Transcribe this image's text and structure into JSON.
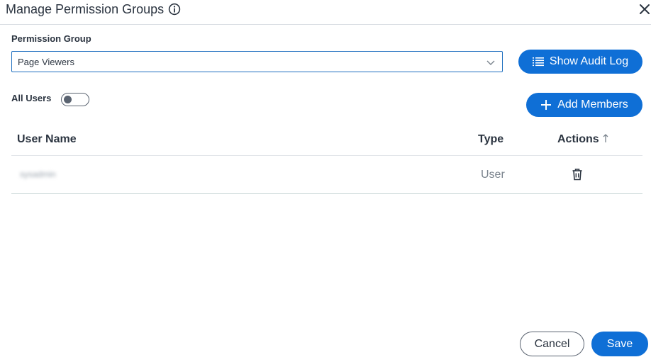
{
  "dialog": {
    "title": "Manage Permission Groups",
    "info_icon": "info-icon",
    "close_icon": "close-icon"
  },
  "permission_group": {
    "label": "Permission Group",
    "selected": "Page Viewers",
    "dropdown_icon": "chevron-down-icon"
  },
  "buttons": {
    "show_audit_log": "Show Audit Log",
    "add_members": "Add Members",
    "cancel": "Cancel",
    "save": "Save"
  },
  "all_users": {
    "label": "All Users",
    "enabled": false
  },
  "table": {
    "columns": [
      "User Name",
      "Type",
      "Actions"
    ],
    "sort_indicator": "↑",
    "rows": [
      {
        "user_name": "sysadmin",
        "type": "User",
        "action_icon": "trash-icon"
      }
    ]
  },
  "colors": {
    "primary": "#0f6fd6",
    "select_border": "#1f6fbf",
    "text": "#2b3440"
  }
}
